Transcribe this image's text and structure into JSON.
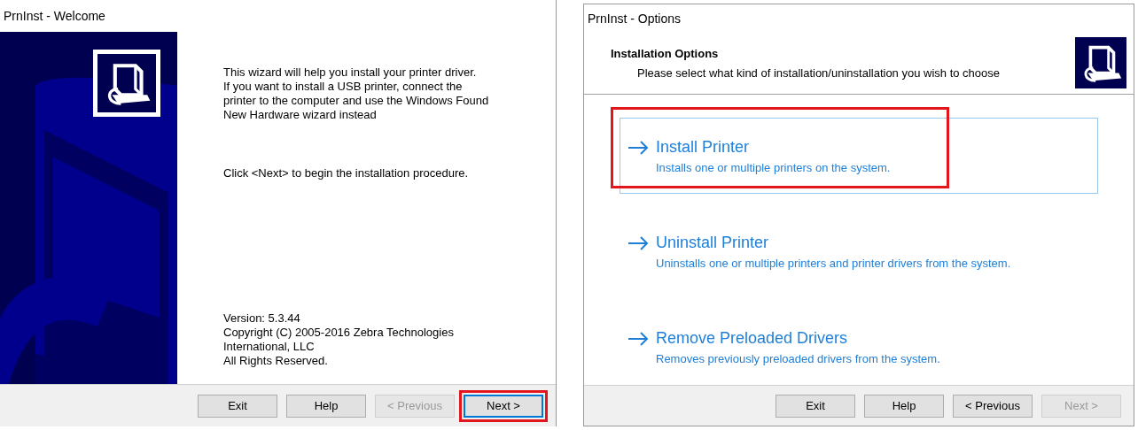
{
  "windows": [
    {
      "kind": "welcome",
      "title": "PrnInst - Welcome",
      "intro": [
        "This wizard will help you install your printer driver.",
        "If you want to install a USB printer, connect the",
        "printer to the computer and use the Windows Found",
        "New Hardware wizard instead"
      ],
      "prompt": "Click <Next> to begin the installation procedure.",
      "about": [
        "Version: 5.3.44",
        "Copyright (C) 2005-2016 Zebra Technologies",
        "International, LLC",
        "All Rights Reserved."
      ],
      "buttons": [
        {
          "label": "Exit",
          "disabled": false,
          "default": false,
          "highlighted": false
        },
        {
          "label": "Help",
          "disabled": false,
          "default": false,
          "highlighted": false
        },
        {
          "label": "< Previous",
          "disabled": true,
          "default": false,
          "highlighted": false
        },
        {
          "label": "Next >",
          "disabled": false,
          "default": true,
          "highlighted": true
        }
      ]
    },
    {
      "kind": "options",
      "title": "PrnInst - Options",
      "heading": "Installation Options",
      "subheading": "Please select what kind of installation/uninstallation you wish to choose",
      "options": [
        {
          "title": "Install Printer",
          "description": "Installs one or multiple printers on the system.",
          "selected": true,
          "highlighted": true
        },
        {
          "title": "Uninstall Printer",
          "description": "Uninstalls one or multiple printers and printer drivers from the system.",
          "selected": false,
          "highlighted": false
        },
        {
          "title": "Remove Preloaded Drivers",
          "description": "Removes previously preloaded drivers from the system.",
          "selected": false,
          "highlighted": false
        }
      ],
      "buttons": [
        {
          "label": "Exit",
          "disabled": false,
          "default": false,
          "highlighted": false
        },
        {
          "label": "Help",
          "disabled": false,
          "default": false,
          "highlighted": false
        },
        {
          "label": "< Previous",
          "disabled": false,
          "default": false,
          "highlighted": false
        },
        {
          "label": "Next >",
          "disabled": true,
          "default": false,
          "highlighted": false
        }
      ]
    }
  ]
}
